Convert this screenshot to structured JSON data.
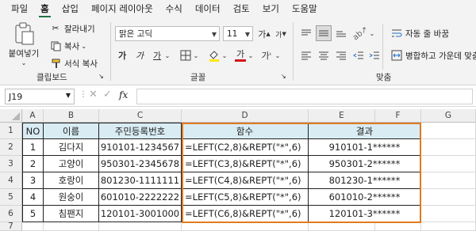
{
  "menu": [
    "파일",
    "홈",
    "삽입",
    "페이지 레이아웃",
    "수식",
    "데이터",
    "검토",
    "보기",
    "도움말"
  ],
  "clipboard": {
    "paste": "붙여넣기",
    "cut": "잘라내기",
    "copy": "복사",
    "format_painter": "서식 복사",
    "label": "클립보드"
  },
  "font": {
    "name": "맑은 고딕",
    "size": "11",
    "bold": "가",
    "italic": "가",
    "underline": "가",
    "grow": "가",
    "shrink": "가",
    "label": "글꼴"
  },
  "align": {
    "wrap": "자동 줄 바꿈",
    "merge": "병합하고 가운데 맞춤",
    "label": "맞춤"
  },
  "namebox": "J19",
  "fx": "fx",
  "columns": [
    "A",
    "B",
    "C",
    "D",
    "E",
    "F",
    "G"
  ],
  "rows": [
    "1",
    "2",
    "3",
    "4",
    "5",
    "6",
    "7"
  ],
  "header": {
    "no": "NO",
    "name": "이름",
    "rrn": "주민등록번호",
    "func": "함수",
    "result": "결과"
  },
  "data": [
    {
      "no": "1",
      "name": "김다지",
      "rrn": "910101-1234567",
      "func": "=LEFT(C2,8)&REPT(\"*\",6)",
      "result": "910101-1******"
    },
    {
      "no": "2",
      "name": "고양이",
      "rrn": "950301-2345678",
      "func": "=LEFT(C3,8)&REPT(\"*\",6)",
      "result": "950301-2******"
    },
    {
      "no": "3",
      "name": "호랑이",
      "rrn": "801230-1111111",
      "func": "=LEFT(C4,8)&REPT(\"*\",6)",
      "result": "801230-1******"
    },
    {
      "no": "4",
      "name": "원숭이",
      "rrn": "601010-2222222",
      "func": "=LEFT(C5,8)&REPT(\"*\",6)",
      "result": "601010-2******"
    },
    {
      "no": "5",
      "name": "침팬지",
      "rrn": "120101-3001000",
      "func": "=LEFT(C6,8)&REPT(\"*\",6)",
      "result": "120101-3******"
    }
  ],
  "colors": {
    "accent": "#217346",
    "highlight": "#e07a1f",
    "header_fill": "#d9ecf3",
    "font_color": "#d0121b",
    "fill_color": "#ffe600"
  }
}
